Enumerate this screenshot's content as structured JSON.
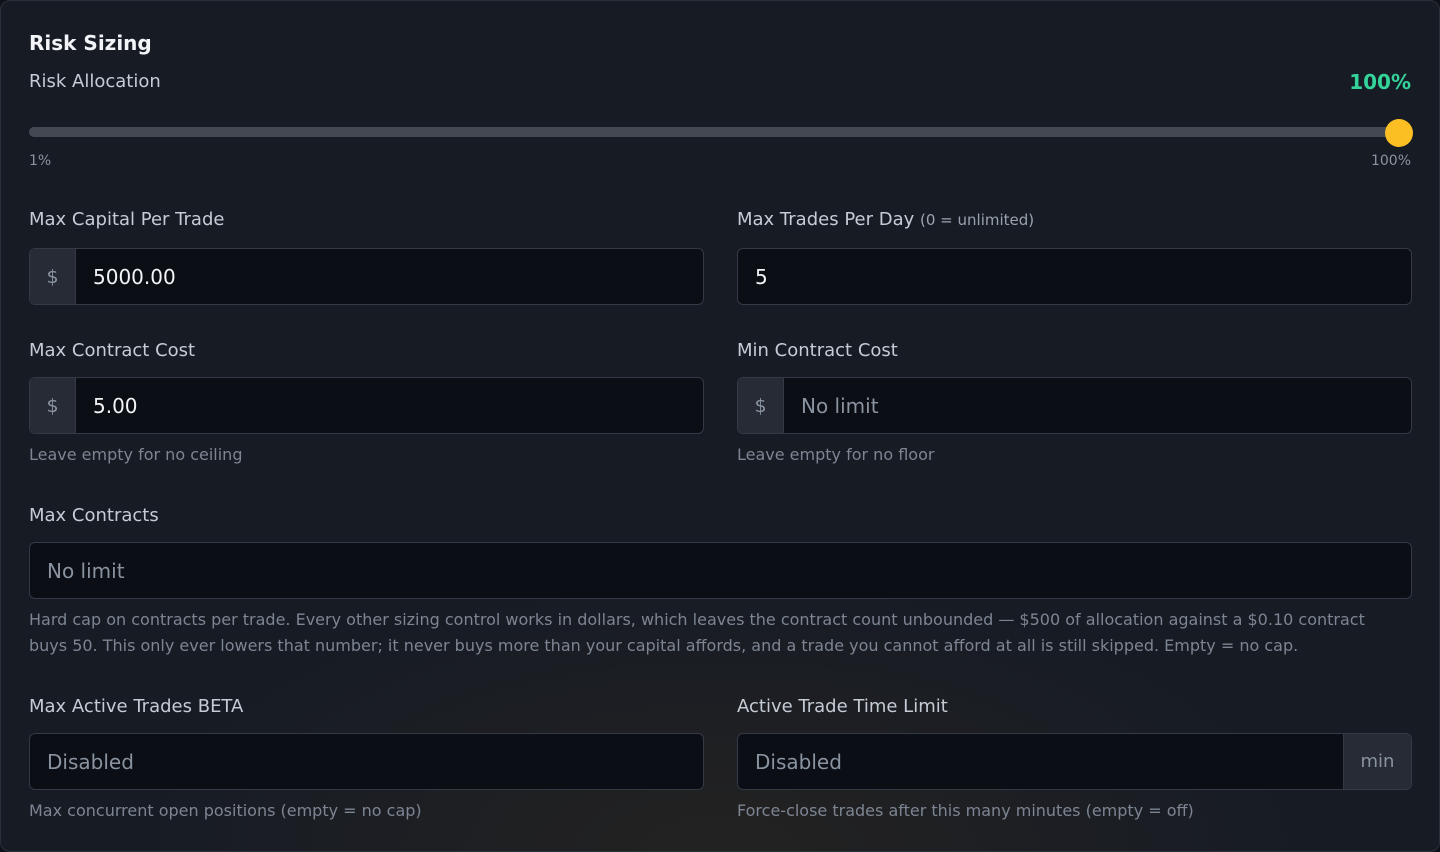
{
  "section": {
    "title": "Risk Sizing"
  },
  "risk_allocation": {
    "label": "Risk Allocation",
    "value_text": "100%",
    "value_fraction": 1.0,
    "min_label": "1%",
    "max_label": "100%",
    "accent_color": "#34d399",
    "thumb_color": "#fbbf24"
  },
  "max_capital_per_trade": {
    "label": "Max Capital Per Trade",
    "prefix": "$",
    "value": "5000.00"
  },
  "max_trades_per_day": {
    "label": "Max Trades Per Day",
    "hint": "(0 = unlimited)",
    "value": "5"
  },
  "max_contract_cost": {
    "label": "Max Contract Cost",
    "prefix": "$",
    "value": "5.00",
    "help": "Leave empty for no ceiling"
  },
  "min_contract_cost": {
    "label": "Min Contract Cost",
    "prefix": "$",
    "placeholder": "No limit",
    "help": "Leave empty for no floor"
  },
  "max_contracts": {
    "label": "Max Contracts",
    "placeholder": "No limit",
    "help": "Hard cap on contracts per trade. Every other sizing control works in dollars, which leaves the contract count unbounded — $500 of allocation against a $0.10 contract buys 50. This only ever lowers that number; it never buys more than your capital affords, and a trade you cannot afford at all is still skipped. Empty = no cap."
  },
  "max_active_trades": {
    "label": "Max Active Trades BETA",
    "placeholder": "Disabled",
    "help": "Max concurrent open positions (empty = no cap)"
  },
  "active_trade_time_limit": {
    "label": "Active Trade Time Limit",
    "placeholder": "Disabled",
    "suffix": "min",
    "help": "Force-close trades after this many minutes (empty = off)"
  }
}
